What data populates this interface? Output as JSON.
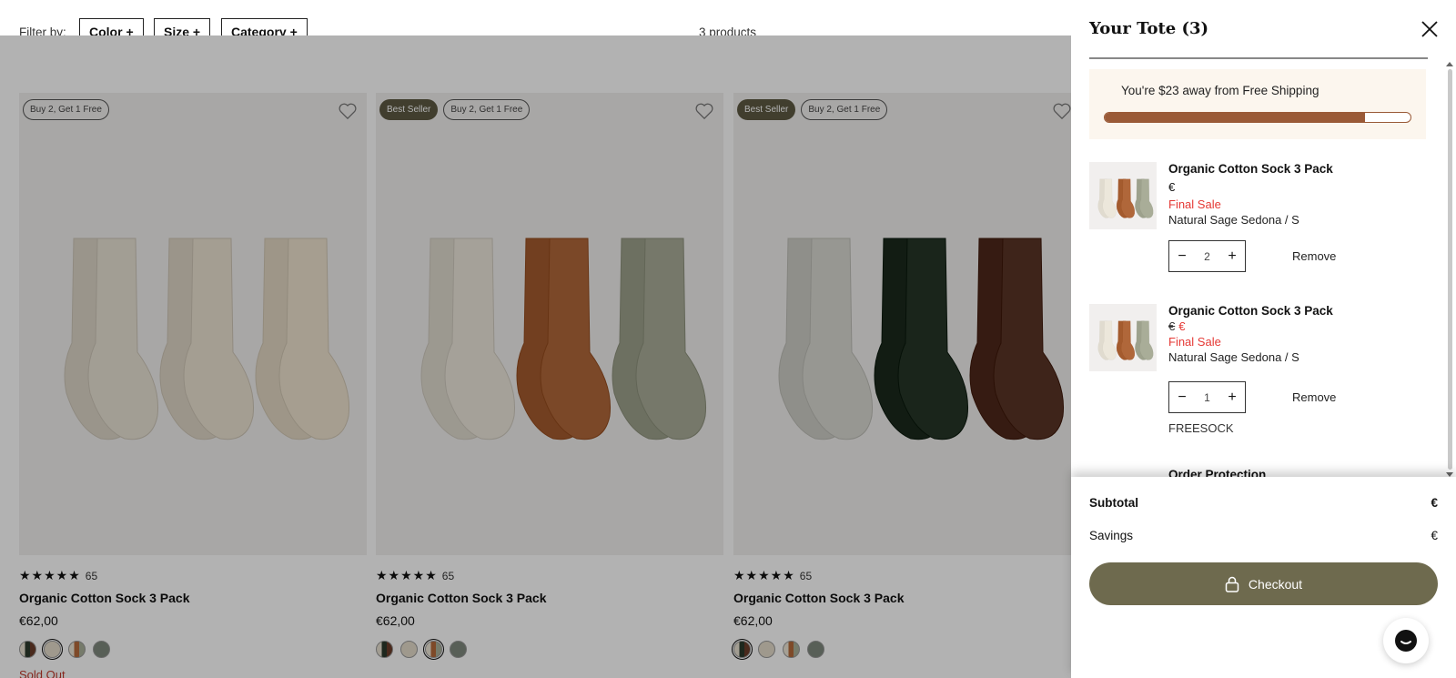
{
  "filters": {
    "label": "Filter by:",
    "buttons": [
      "Color +",
      "Size +",
      "Category +"
    ],
    "count": "3 products"
  },
  "products": [
    {
      "badges": [
        "Buy 2, Get 1 Free"
      ],
      "rating_count": "65",
      "name": "Organic Cotton Sock 3 Pack",
      "price": "€62,00",
      "sold_out": "Sold Out",
      "sock_colors": [
        "#e9e2d4",
        "#ebe2d2",
        "#eee3cf"
      ]
    },
    {
      "badges": [
        "Best Seller",
        "Buy 2, Get 1 Free"
      ],
      "rating_count": "65",
      "name": "Organic Cotton Sock 3 Pack",
      "price": "€62,00",
      "sold_out": "",
      "sock_colors": [
        "#ece7db",
        "#b0673a",
        "#a9ad98"
      ]
    },
    {
      "badges": [
        "Best Seller",
        "Buy 2, Get 1 Free"
      ],
      "rating_count": "65",
      "name": "Organic Cotton Sock 3 Pack",
      "price": "€62,00",
      "sold_out": "",
      "sock_colors": [
        "#d9d9d2",
        "#263528",
        "#5a3426"
      ]
    }
  ],
  "cart": {
    "title": "Your Tote (3)",
    "shipping": {
      "message": "You're $23 away from Free Shipping",
      "progress": 0.85,
      "bar_color": "#9a5a37"
    },
    "items": [
      {
        "name": "Organic Cotton Sock 3 Pack",
        "price_original": "€",
        "price_sale": "",
        "final_sale": "Final Sale",
        "variant": "Natural Sage Sedona / S",
        "quantity": "2",
        "remove": "Remove"
      },
      {
        "name": "Organic Cotton Sock 3 Pack",
        "price_original": "€",
        "price_sale": "€",
        "final_sale": "Final Sale",
        "variant": "Natural Sage Sedona / S",
        "quantity": "1",
        "remove": "Remove",
        "promo_code": "FREESOCK"
      }
    ],
    "order_protection": "Order Protection",
    "subtotal_label": "Subtotal",
    "subtotal_value": "€",
    "savings_label": "Savings",
    "savings_value": "€",
    "checkout_label": "Checkout",
    "accent_color": "#6e6a4e"
  }
}
